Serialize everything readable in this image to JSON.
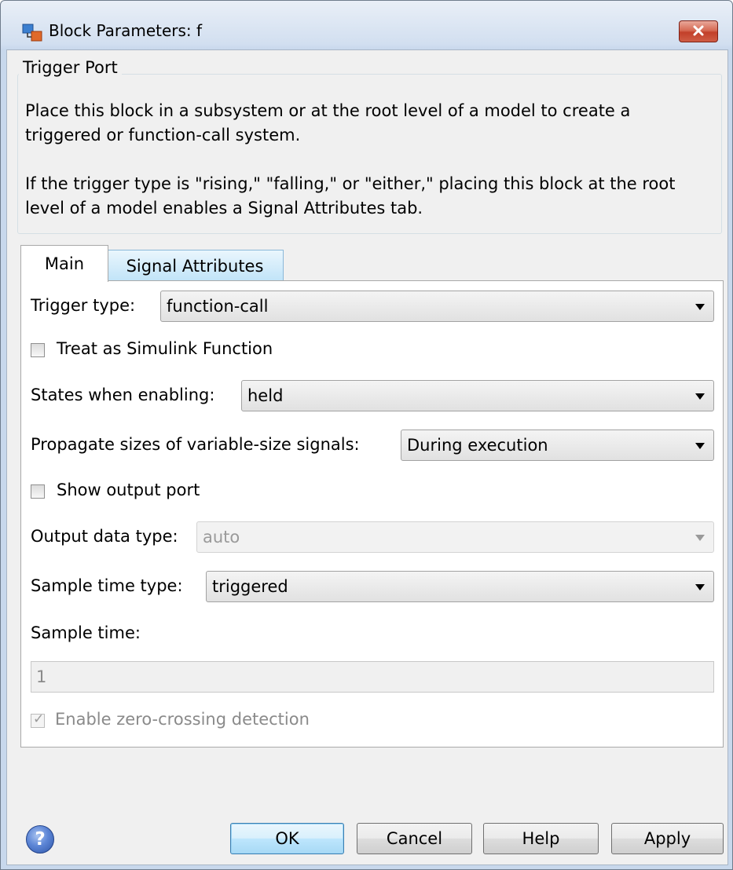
{
  "window": {
    "title": "Block Parameters: f"
  },
  "group": {
    "legend": "Trigger Port",
    "paragraphs": [
      "Place this block in a subsystem or at the root level of a model to create a triggered or function-call system.",
      "If the trigger type is \"rising,\" \"falling,\" or \"either,\" placing this block at the root level of a model enables a Signal Attributes tab."
    ]
  },
  "tabs": [
    {
      "label": "Main",
      "selected": true
    },
    {
      "label": "Signal Attributes",
      "selected": false
    }
  ],
  "main": {
    "trigger_type": {
      "label": "Trigger type:",
      "value": "function-call"
    },
    "treat_as_simulink_function": {
      "label": "Treat as Simulink Function",
      "checked": false
    },
    "states_when_enabling": {
      "label": "States when enabling:",
      "value": "held"
    },
    "propagate_sizes": {
      "label": "Propagate sizes of variable-size signals:",
      "value": "During execution"
    },
    "show_output_port": {
      "label": "Show output port",
      "checked": false
    },
    "output_data_type": {
      "label": "Output data type:",
      "value": "auto",
      "enabled": false
    },
    "sample_time_type": {
      "label": "Sample time type:",
      "value": "triggered"
    },
    "sample_time": {
      "label": "Sample time:",
      "value": "1",
      "enabled": false
    },
    "zero_crossing": {
      "label": "Enable zero-crossing detection",
      "checked": true,
      "enabled": false
    }
  },
  "buttons": {
    "ok": "OK",
    "cancel": "Cancel",
    "help": "Help",
    "apply": "Apply"
  },
  "icons": {
    "app": "block-parameters-icon",
    "close": "close-icon",
    "help": "help-icon"
  },
  "colors": {
    "close_button": "#c2402a",
    "default_button_border": "#3c7fb1",
    "tab_inactive": "#bfe3f8"
  }
}
